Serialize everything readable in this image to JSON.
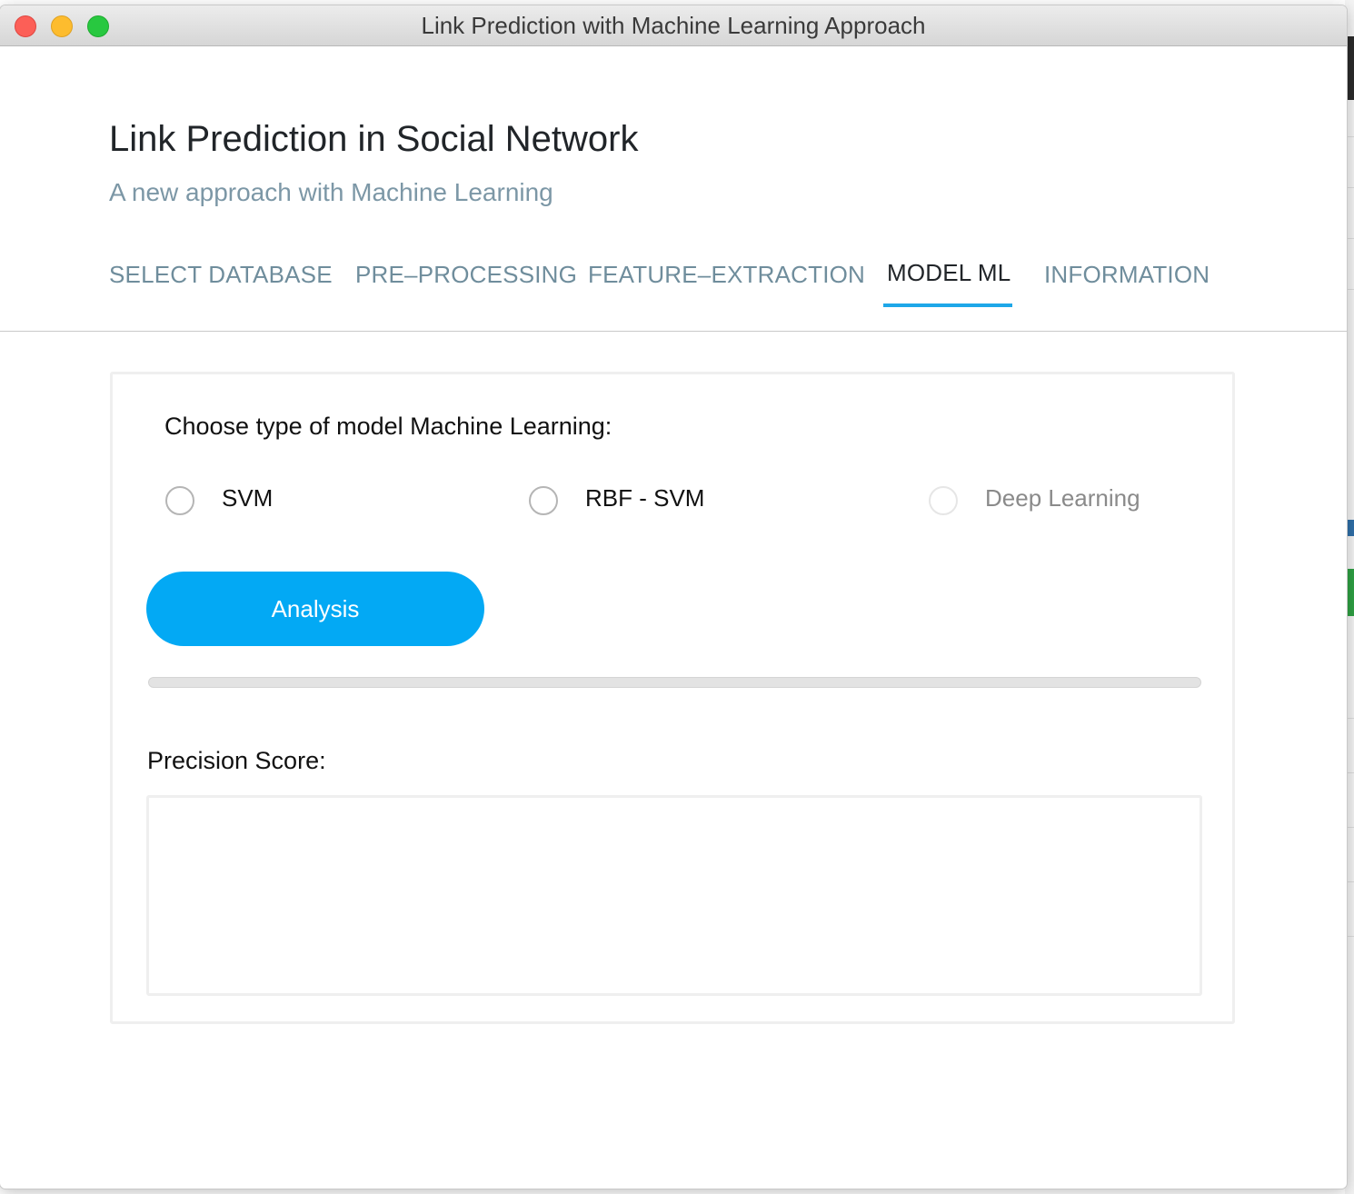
{
  "window": {
    "title": "Link Prediction with Machine Learning Approach"
  },
  "header": {
    "title": "Link Prediction in Social Network",
    "subtitle": "A new approach with Machine Learning"
  },
  "tabs": [
    {
      "label": "SELECT DATABASE",
      "active": false
    },
    {
      "label": "PRE–PROCESSING",
      "active": false
    },
    {
      "label": "FEATURE–EXTRACTION",
      "active": false
    },
    {
      "label": "MODEL ML",
      "active": true
    },
    {
      "label": "INFORMATION",
      "active": false
    }
  ],
  "model_panel": {
    "prompt": "Choose type of model Machine Learning:",
    "options": [
      {
        "label": "SVM",
        "selected": false,
        "enabled": true
      },
      {
        "label": "RBF - SVM",
        "selected": false,
        "enabled": true
      },
      {
        "label": "Deep Learning",
        "selected": false,
        "enabled": false
      }
    ],
    "analysis_button": "Analysis",
    "progress": 0,
    "precision_label": "Precision Score:",
    "precision_value": ""
  },
  "colors": {
    "accent": "#03a9f4",
    "tab_underline": "#1ea7e8",
    "tab_inactive": "#6f8d9c",
    "subtitle": "#7c97a6"
  }
}
